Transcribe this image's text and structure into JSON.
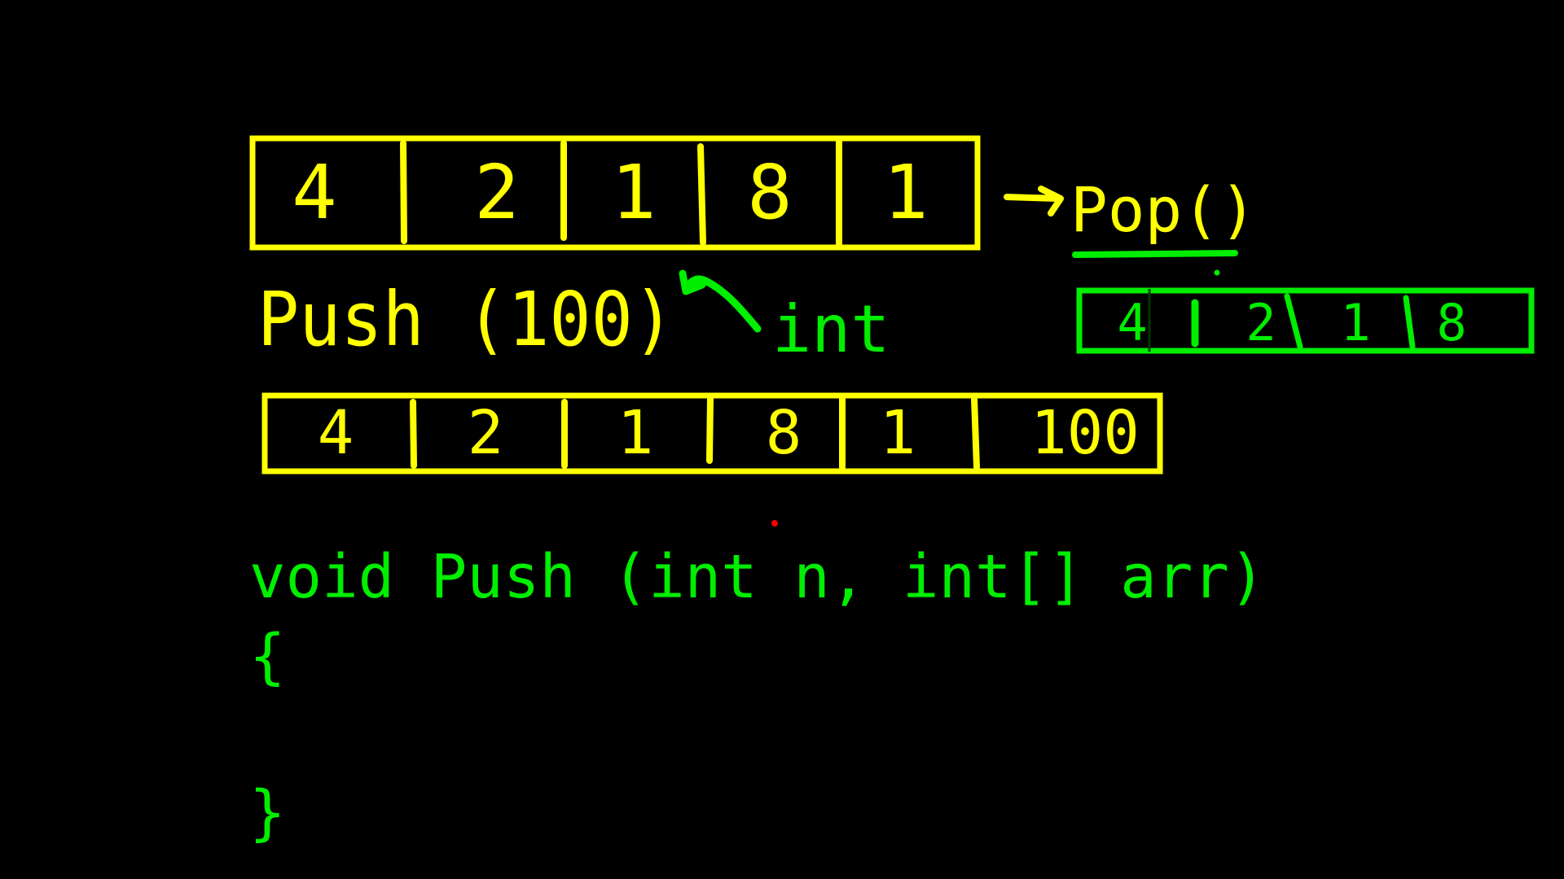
{
  "colors": {
    "background": "#000000",
    "yellow": "#ffff00",
    "green": "#00ee00",
    "red": "#ff0000"
  },
  "array_top": {
    "values": [
      "4",
      "2",
      "1",
      "8",
      "1"
    ]
  },
  "pop_label": "Pop()",
  "array_pop_result": {
    "values": [
      "4",
      "2",
      "1",
      "8"
    ]
  },
  "push_label": "Push (100)",
  "int_label": "int",
  "array_after_push": {
    "values": [
      "4",
      "2",
      "1",
      "8",
      "1",
      "100"
    ]
  },
  "code": {
    "signature": "void Push (int n, int[] arr)",
    "open_brace": "{",
    "close_brace": "}"
  }
}
